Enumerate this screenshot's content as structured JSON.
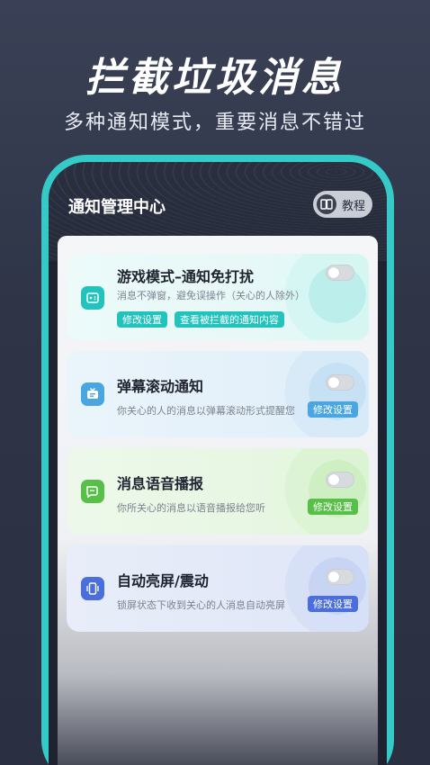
{
  "promo": {
    "title": "拦截垃圾消息",
    "subtitle": "多种通知模式，重要消息不错过"
  },
  "app": {
    "title": "通知管理中心",
    "tutorial_label": "教程"
  },
  "cards": [
    {
      "title": "游戏模式–通知免打扰",
      "desc": "消息不弹窗，避免误操作（关心的人除外）",
      "toggle_on": false,
      "actions": [
        "修改设置",
        "查看被拦截的通知内容"
      ],
      "accent": "#22c3bd",
      "icon": "gamepad-icon"
    },
    {
      "title": "弹幕滚动通知",
      "desc": "你关心的人的消息以弹幕滚动形式提醒您",
      "toggle_on": false,
      "actions": [
        "修改设置"
      ],
      "accent": "#4aa6e0",
      "icon": "tv-icon"
    },
    {
      "title": "消息语音播报",
      "desc": "你所关心的消息以语音播报给您听",
      "toggle_on": false,
      "actions": [
        "修改设置"
      ],
      "accent": "#58bf48",
      "icon": "chat-bubble-icon"
    },
    {
      "title": "自动亮屏/震动",
      "desc": "锁屏状态下收到关心的人消息自动亮屏",
      "toggle_on": false,
      "actions": [
        "修改设置"
      ],
      "accent": "#4a6fdd",
      "icon": "phone-vibrate-icon"
    }
  ]
}
